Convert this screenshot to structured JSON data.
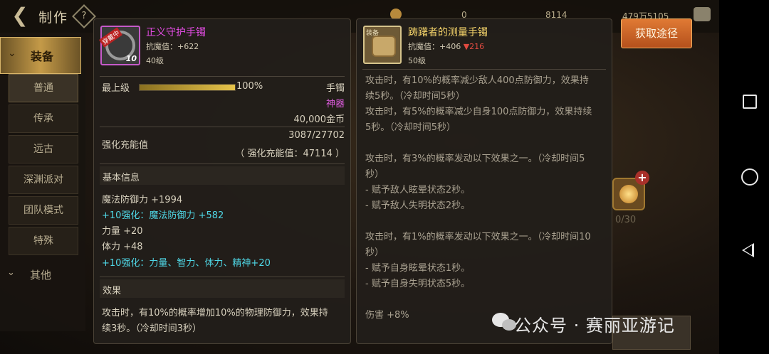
{
  "header": {
    "title": "制作",
    "help": "?",
    "stats": [
      "0",
      "8114",
      "479万5105"
    ]
  },
  "sidebar": {
    "main": "装备",
    "items": [
      {
        "label": "普通"
      },
      {
        "label": "传承"
      },
      {
        "label": "远古"
      },
      {
        "label": "深渊派对"
      },
      {
        "label": "团队模式"
      },
      {
        "label": "特殊"
      }
    ],
    "other": "其他"
  },
  "left_card": {
    "icon_tag": "穿戴中",
    "icon_level": "10",
    "name": "正义守护手镯",
    "resist_label": "抗魔值：",
    "resist_value": "+622",
    "level": "40级",
    "grade": "最上级",
    "grade_percent": "100%",
    "grade_fill": 1.0,
    "type": "手镯",
    "rarity": "神器",
    "price": "40,000金币",
    "reinforce_label": "强化充能值",
    "reinforce_value": "3087/27702",
    "reinforce_note": "（ 强化充能值：47114 ）",
    "basic_title": "基本信息",
    "stats": [
      {
        "text": "魔法防御力 +1994",
        "style": "normal"
      },
      {
        "text": "+10强化：魔法防御力 +582",
        "style": "cyan"
      },
      {
        "text": "力量 +20",
        "style": "normal"
      },
      {
        "text": "体力 +48",
        "style": "normal"
      },
      {
        "text": "+10强化：力量、智力、体力、精神+20",
        "style": "cyan"
      }
    ],
    "effect_title": "效果",
    "effect_lines": [
      "攻击时，有10%的概率增加10%的物理防御力，效果持",
      "续3秒。（冷却时间3秒）"
    ]
  },
  "right_card": {
    "icon_tag": "装备",
    "name": "踌躇者的测量手镯",
    "resist_label": "抗魔值：",
    "resist_value": "+406",
    "resist_down": "▼216",
    "level": "50级",
    "lines": [
      "攻击时，有10%的概率减少敌人400点防御力，效果持",
      "续5秒。（冷却时间5秒）",
      "攻击时，有5%的概率减少自身100点防御力，效果持续",
      "5秒。（冷却时间5秒）",
      "",
      "攻击时，有3%的概率发动以下效果之一。（冷却时间5",
      "秒）",
      "- 赋予敌人眩晕状态2秒。",
      "- 赋予敌人失明状态2秒。",
      "",
      "攻击时，有1%的概率发动以下效果之一。（冷却时间10",
      "秒）",
      "- 赋予自身眩晕状态1秒。",
      "- 赋予自身失明状态5秒。",
      "",
      "伤害 +8%"
    ]
  },
  "obtain_button": "获取途径",
  "gem_count": "0/30",
  "watermark": "公众号 · 赛丽亚游记"
}
